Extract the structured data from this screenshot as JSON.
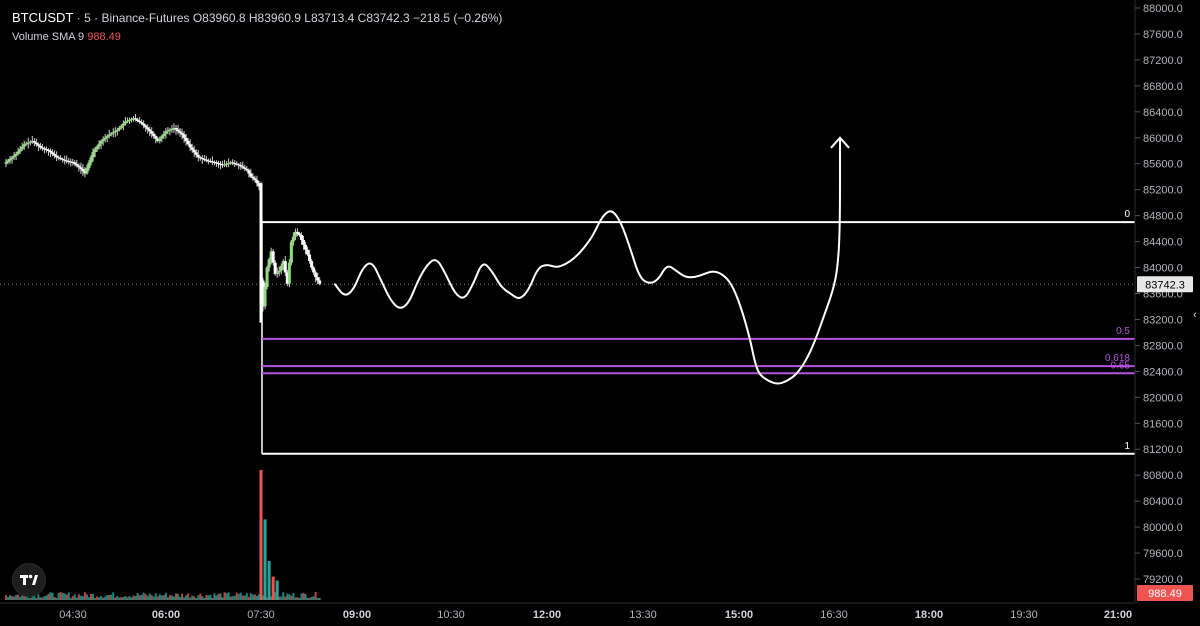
{
  "header": {
    "symbol": "BTCUSDT",
    "interval": "5",
    "exchange": "Binance-Futures",
    "ohlc": "O83960.8 H83960.9 L83713.4 C83742.3 −218.5 (−0.26%)",
    "sma_label": "Volume SMA 9",
    "sma_value": "988.49"
  },
  "colors": {
    "background": "#000000",
    "up": "#26a69a",
    "up_body": "#8ee07a",
    "down": "#ef5350",
    "fib_white": "#ffffff",
    "fib_purple": "#b454e0"
  },
  "chart_data": {
    "type": "candlestick",
    "x_ticks": [
      "04:30",
      "06:00",
      "07:30",
      "09:00",
      "10:30",
      "12:00",
      "13:30",
      "15:00",
      "16:30",
      "18:00",
      "19:30",
      "21:00"
    ],
    "y_ticks": [
      "88000.0",
      "87600.0",
      "87200.0",
      "86800.0",
      "86400.0",
      "86000.0",
      "85600.0",
      "85200.0",
      "84800.0",
      "84400.0",
      "84000.0",
      "83600.0",
      "83200.0",
      "82800.0",
      "82400.0",
      "82000.0",
      "81600.0",
      "81200.0",
      "80800.0",
      "80400.0",
      "80000.0",
      "79600.0",
      "79200.0"
    ],
    "ylim": [
      79100,
      88050
    ],
    "last_price": "83742.3",
    "volume_sma_value": "988.49",
    "fib_levels": [
      {
        "label": "0",
        "price": 84700,
        "color": "white"
      },
      {
        "label": "0.5",
        "price": 82900,
        "color": "purple"
      },
      {
        "label": "0.618",
        "price": 82480,
        "color": "purple"
      },
      {
        "label": "0.65",
        "price": 82370,
        "color": "purple"
      },
      {
        "label": "1",
        "price": 81130,
        "color": "white"
      }
    ],
    "price_path": [
      [
        0,
        85600
      ],
      [
        6,
        85750
      ],
      [
        10,
        85900
      ],
      [
        14,
        85950
      ],
      [
        18,
        85850
      ],
      [
        22,
        85800
      ],
      [
        26,
        85700
      ],
      [
        30,
        85650
      ],
      [
        34,
        85620
      ],
      [
        38,
        85520
      ],
      [
        40,
        85450
      ],
      [
        44,
        85780
      ],
      [
        48,
        85950
      ],
      [
        52,
        86050
      ],
      [
        56,
        86120
      ],
      [
        60,
        86250
      ],
      [
        64,
        86300
      ],
      [
        68,
        86220
      ],
      [
        72,
        86100
      ],
      [
        76,
        85950
      ],
      [
        80,
        86100
      ],
      [
        84,
        86150
      ],
      [
        88,
        86050
      ],
      [
        92,
        85850
      ],
      [
        96,
        85700
      ],
      [
        100,
        85650
      ],
      [
        104,
        85620
      ],
      [
        108,
        85580
      ],
      [
        112,
        85620
      ],
      [
        116,
        85580
      ],
      [
        120,
        85500
      ],
      [
        122,
        85400
      ],
      [
        124,
        85350
      ],
      [
        126,
        85250
      ],
      [
        127,
        83800
      ],
      [
        128,
        83400
      ],
      [
        130,
        84000
      ],
      [
        132,
        84250
      ],
      [
        134,
        83900
      ],
      [
        136,
        83950
      ],
      [
        138,
        84100
      ],
      [
        140,
        83750
      ],
      [
        142,
        84400
      ],
      [
        144,
        84550
      ],
      [
        146,
        84500
      ],
      [
        148,
        84350
      ],
      [
        150,
        84200
      ],
      [
        152,
        84000
      ],
      [
        154,
        83850
      ],
      [
        156,
        83750
      ]
    ],
    "projection_path": [
      [
        156,
        83742
      ],
      [
        160,
        83550
      ],
      [
        164,
        83650
      ],
      [
        168,
        84000
      ],
      [
        172,
        84100
      ],
      [
        176,
        83800
      ],
      [
        180,
        83500
      ],
      [
        184,
        83350
      ],
      [
        188,
        83450
      ],
      [
        192,
        83800
      ],
      [
        196,
        84050
      ],
      [
        200,
        84150
      ],
      [
        204,
        83900
      ],
      [
        208,
        83600
      ],
      [
        212,
        83500
      ],
      [
        216,
        83750
      ],
      [
        220,
        84100
      ],
      [
        224,
        83950
      ],
      [
        228,
        83700
      ],
      [
        232,
        83600
      ],
      [
        236,
        83500
      ],
      [
        240,
        83650
      ],
      [
        244,
        84000
      ],
      [
        248,
        84050
      ],
      [
        252,
        84000
      ],
      [
        256,
        84050
      ],
      [
        260,
        84150
      ],
      [
        264,
        84300
      ],
      [
        268,
        84500
      ],
      [
        272,
        84800
      ],
      [
        276,
        84900
      ],
      [
        280,
        84700
      ],
      [
        284,
        84300
      ],
      [
        288,
        83850
      ],
      [
        292,
        83750
      ],
      [
        296,
        83800
      ],
      [
        300,
        84050
      ],
      [
        304,
        83950
      ],
      [
        308,
        83850
      ],
      [
        312,
        83850
      ],
      [
        316,
        83900
      ],
      [
        320,
        83950
      ],
      [
        324,
        83900
      ],
      [
        328,
        83750
      ],
      [
        332,
        83400
      ],
      [
        336,
        82900
      ],
      [
        338,
        82550
      ],
      [
        340,
        82350
      ],
      [
        344,
        82250
      ],
      [
        348,
        82200
      ],
      [
        352,
        82250
      ],
      [
        356,
        82350
      ],
      [
        360,
        82550
      ],
      [
        364,
        82850
      ],
      [
        368,
        83250
      ],
      [
        372,
        83650
      ],
      [
        374,
        84000
      ],
      [
        375,
        84600
      ],
      [
        375,
        86000
      ]
    ],
    "volume_spikes": [
      {
        "i": 126,
        "v": 1.0,
        "color": "down"
      },
      {
        "i": 128,
        "v": 0.62,
        "color": "up"
      },
      {
        "i": 130,
        "v": 0.3,
        "color": "up"
      },
      {
        "i": 132,
        "v": 0.18,
        "color": "down"
      },
      {
        "i": 134,
        "v": 0.15,
        "color": "up"
      }
    ]
  }
}
